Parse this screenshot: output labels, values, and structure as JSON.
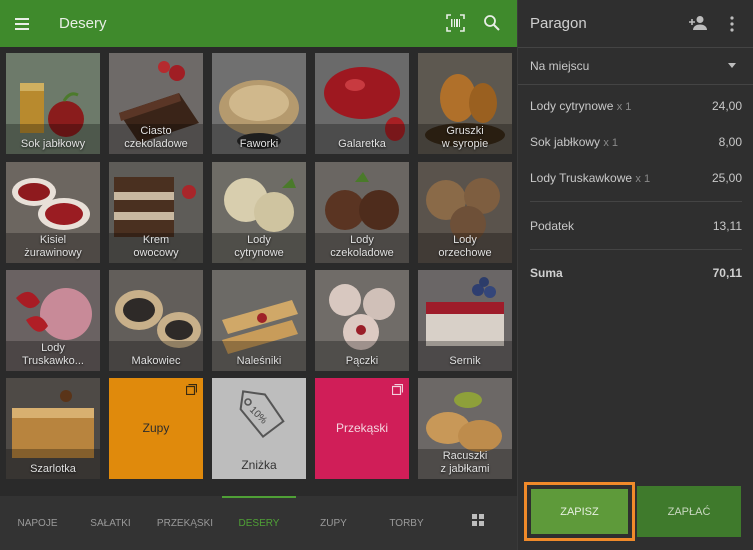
{
  "topbar": {
    "title": "Desery"
  },
  "tiles": [
    {
      "caption": "Sok jabłkowy"
    },
    {
      "caption": "Ciasto\nczekoladowe"
    },
    {
      "caption": "Faworki"
    },
    {
      "caption": "Galaretka"
    },
    {
      "caption": "Gruszki\nw syropie"
    },
    {
      "caption": "Kisiel\nżurawinowy"
    },
    {
      "caption": "Krem\nowocowy"
    },
    {
      "caption": "Lody\ncytrynowe"
    },
    {
      "caption": "Lody\nczekoladowe"
    },
    {
      "caption": "Lody\norzechowe"
    },
    {
      "caption": "Lody\nTruskawko..."
    },
    {
      "caption": "Makowiec"
    },
    {
      "caption": "Naleśniki"
    },
    {
      "caption": "Pączki"
    },
    {
      "caption": "Sernik"
    },
    {
      "caption": "Szarlotka"
    },
    {
      "caption": "Zupy"
    },
    {
      "caption": "Zniżka",
      "badge": "10%"
    },
    {
      "caption": "Przekąski"
    },
    {
      "caption": "Racuszki\nz jabłkami"
    }
  ],
  "tabs": [
    {
      "label": "NAPOJE"
    },
    {
      "label": "SAŁATKI"
    },
    {
      "label": "PRZEKĄSKI"
    },
    {
      "label": "DESERY"
    },
    {
      "label": "ZUPY"
    },
    {
      "label": "TORBY"
    }
  ],
  "receipt": {
    "title": "Paragon",
    "dining": "Na miejscu",
    "items": [
      {
        "name": "Lody cytrynowe",
        "qty": "x 1",
        "amount": "24,00"
      },
      {
        "name": "Sok jabłkowy",
        "qty": "x 1",
        "amount": "8,00"
      },
      {
        "name": "Lody Truskawkowe",
        "qty": "x 1",
        "amount": "25,00"
      }
    ],
    "tax_label": "Podatek",
    "tax_amount": "13,11",
    "total_label": "Suma",
    "total_amount": "70,11",
    "save_label": "ZAPISZ",
    "pay_label": "ZAPŁAĆ"
  },
  "colors": {
    "brand_green": "#3f8a2c",
    "active_tab": "#4fa036",
    "highlight_border": "#f08a2a",
    "zupy_tile": "#e08a0c",
    "przekaski_tile": "#d01e58"
  },
  "icons": {
    "menu": "menu-icon",
    "barcode": "barcode-icon",
    "search": "search-icon",
    "add_customer": "add-person-icon",
    "more": "more-vert-icon",
    "grid_view": "grid-view-icon",
    "folder": "folder-icon",
    "tag": "price-tag-icon"
  }
}
